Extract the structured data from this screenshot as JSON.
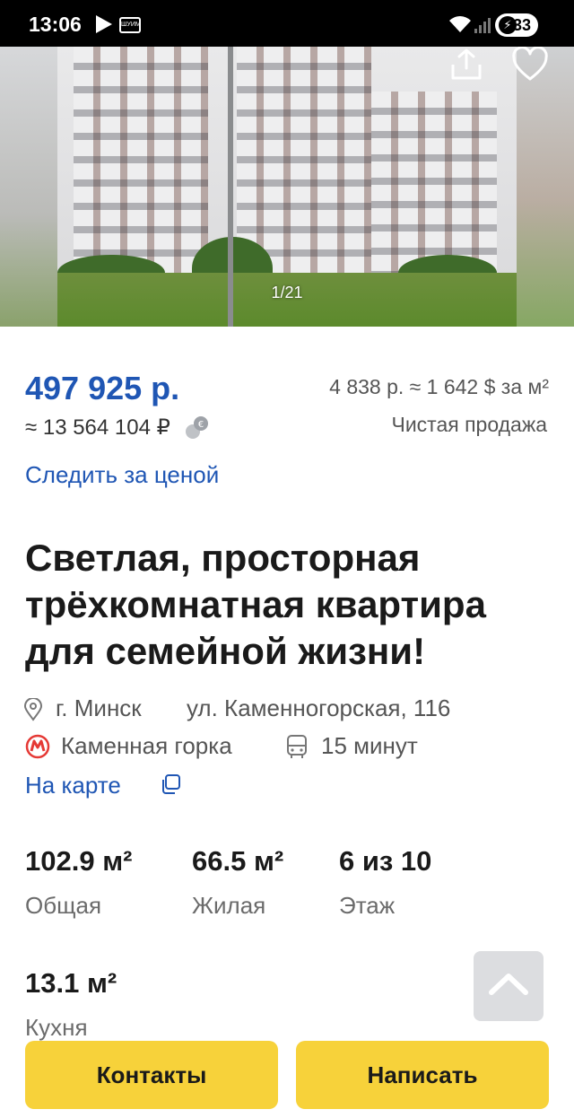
{
  "status_bar": {
    "time": "13:06",
    "app_badge": "ШУИМ",
    "battery": "33"
  },
  "gallery": {
    "counter": "1/21"
  },
  "price": {
    "main": "497 925 р.",
    "rub": "≈ 13 564 104 ₽",
    "per_sqm": "4 838 р. ≈ 1 642 $ за м²",
    "sale_type": "Чистая продажа",
    "track_label": "Следить за ценой"
  },
  "listing": {
    "title": "Светлая, просторная трёхкомнатная квартира для семейной жизни!",
    "city": "г. Минск",
    "street": "ул. Каменногорская, 116",
    "metro": "Каменная горка",
    "metro_time": "15 минут",
    "map_link": "На карте"
  },
  "specs": [
    {
      "value": "102.9 м²",
      "label": "Общая"
    },
    {
      "value": "66.5 м²",
      "label": "Жилая"
    },
    {
      "value": "6 из 10",
      "label": "Этаж"
    },
    {
      "value": "13.1 м²",
      "label": "Кухня"
    }
  ],
  "actions": {
    "contacts": "Контакты",
    "write": "Написать"
  },
  "colors": {
    "accent": "#1f56b4",
    "button": "#f7d23a",
    "metro": "#e53935"
  }
}
